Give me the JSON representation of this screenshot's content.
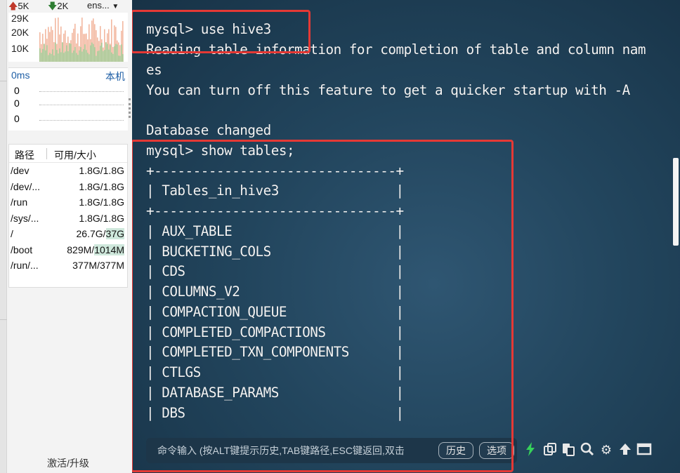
{
  "sidebar": {
    "net": {
      "upload": "5K",
      "download": "2K",
      "interface": "ens...",
      "y_ticks": [
        "29K",
        "20K",
        "10K"
      ]
    },
    "latency": {
      "value": "0ms",
      "host": "本机",
      "rows": [
        "0",
        "0",
        "0"
      ]
    },
    "disk": {
      "headers": [
        "路径",
        "可用/大小"
      ],
      "rows": [
        {
          "path": "/dev",
          "size": "1.8G/1.8G"
        },
        {
          "path": "/dev/...",
          "size": "1.8G/1.8G"
        },
        {
          "path": "/run",
          "size": "1.8G/1.8G"
        },
        {
          "path": "/sys/...",
          "size": "1.8G/1.8G"
        },
        {
          "path": "/",
          "size_used": "26.7G/",
          "size_total": "37G"
        },
        {
          "path": "/boot",
          "size_used": "829M/",
          "size_total": "1014M"
        },
        {
          "path": "/run/...",
          "size": "377M/377M"
        }
      ]
    },
    "upgrade_label": "激活/升级"
  },
  "terminal": {
    "lines": [
      "mysql> use hive3",
      "Reading table information for completion of table and column nam",
      "es",
      "You can turn off this feature to get a quicker startup with -A",
      "",
      "Database changed",
      "mysql> show tables;",
      "+-------------------------------+",
      "| Tables_in_hive3               |",
      "+-------------------------------+",
      "| AUX_TABLE                     |",
      "| BUCKETING_COLS                |",
      "| CDS                           |",
      "| COLUMNS_V2                    |",
      "| COMPACTION_QUEUE              |",
      "| COMPLETED_COMPACTIONS         |",
      "| COMPLETED_TXN_COMPONENTS      |",
      "| CTLGS                         |",
      "| DATABASE_PARAMS               |",
      "| DBS                           |"
    ]
  },
  "command_bar": {
    "placeholder": "命令输入 (按ALT键提示历史,TAB键路径,ESC键返回,双击",
    "history_label": "历史",
    "options_label": "选项"
  },
  "toolbar_icons": [
    "lightning-icon",
    "copy-icon",
    "paste-icon",
    "search-icon",
    "gear-icon",
    "up-arrow-icon",
    "maximize-icon"
  ],
  "colors": {
    "highlight_box": "#e53935",
    "lightning": "#36d15a"
  }
}
